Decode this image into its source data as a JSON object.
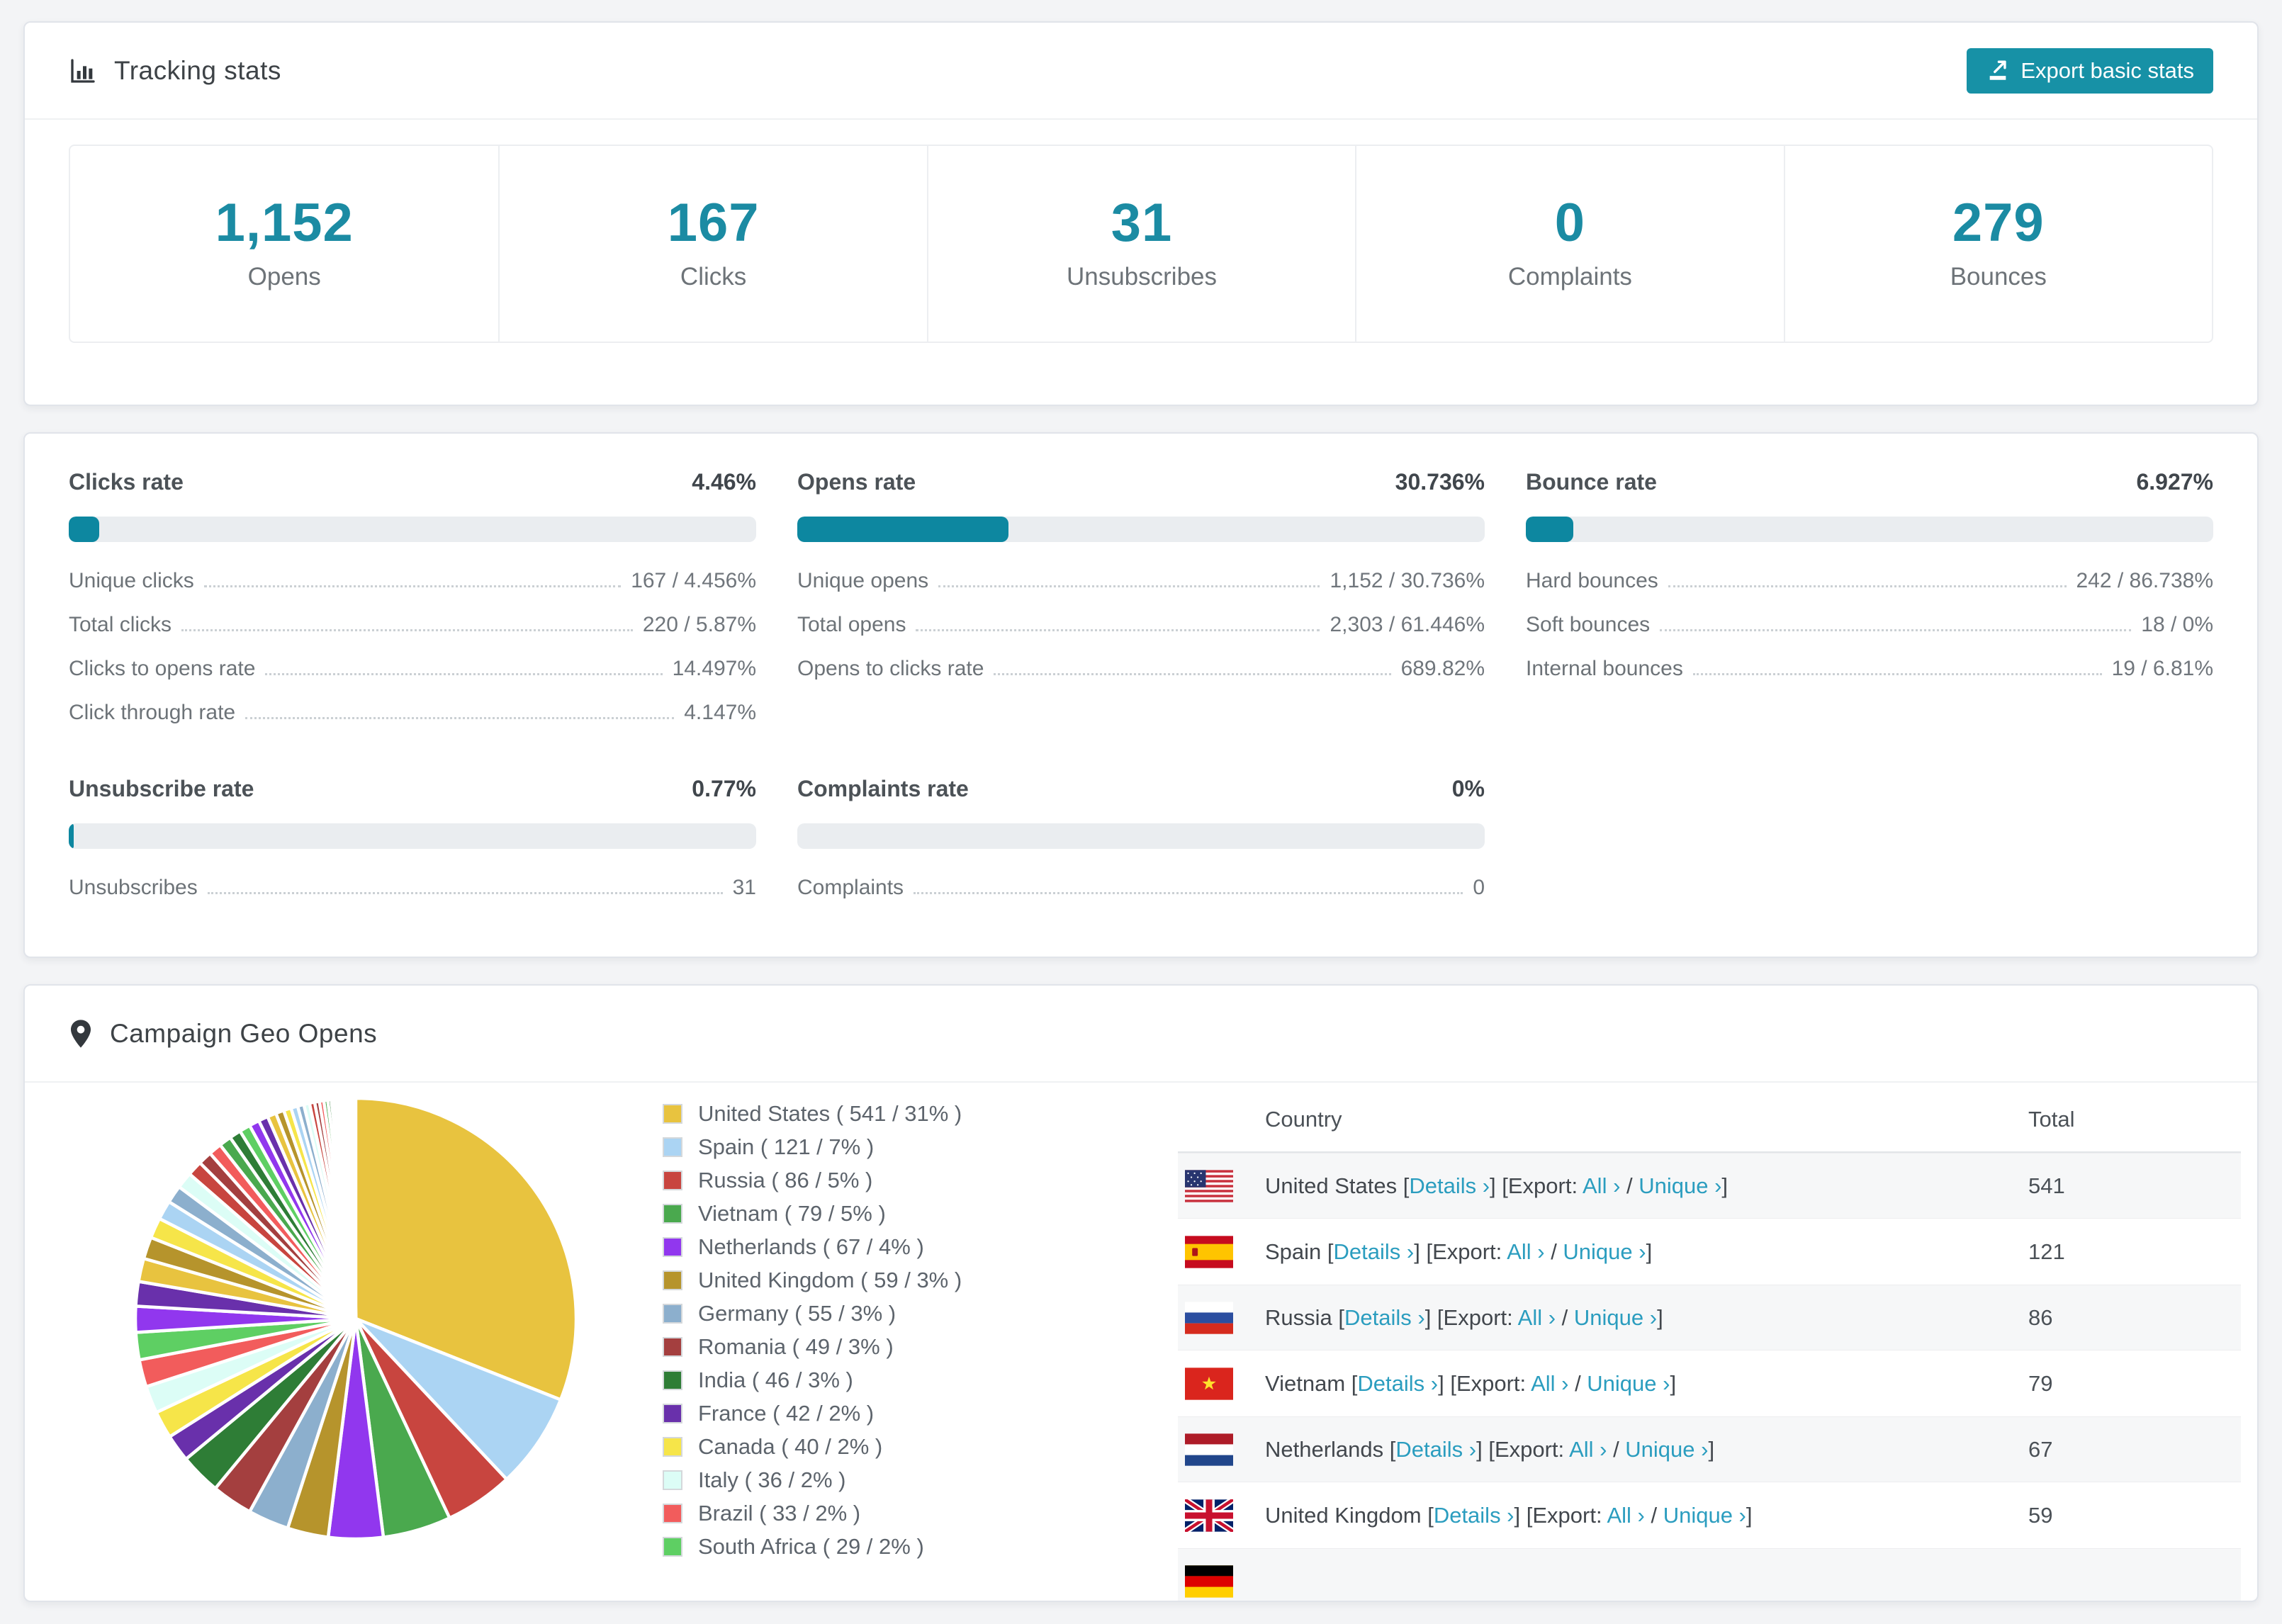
{
  "accent_color": "#1791a6",
  "link_color": "#2b9dbf",
  "header": {
    "title": "Tracking stats",
    "export_label": "Export basic stats"
  },
  "summary_cards": [
    {
      "value": "1,152",
      "label": "Opens"
    },
    {
      "value": "167",
      "label": "Clicks"
    },
    {
      "value": "31",
      "label": "Unsubscribes"
    },
    {
      "value": "0",
      "label": "Complaints"
    },
    {
      "value": "279",
      "label": "Bounces"
    }
  ],
  "rates": [
    {
      "title": "Clicks rate",
      "value": "4.46%",
      "pct": 4.46,
      "rows": [
        {
          "label": "Unique clicks",
          "value": "167 / 4.456%"
        },
        {
          "label": "Total clicks",
          "value": "220 / 5.87%"
        },
        {
          "label": "Clicks to opens rate",
          "value": "14.497%"
        },
        {
          "label": "Click through rate",
          "value": "4.147%"
        }
      ]
    },
    {
      "title": "Opens rate",
      "value": "30.736%",
      "pct": 30.736,
      "rows": [
        {
          "label": "Unique opens",
          "value": "1,152 / 30.736%"
        },
        {
          "label": "Total opens",
          "value": "2,303 / 61.446%"
        },
        {
          "label": "Opens to clicks rate",
          "value": "689.82%"
        }
      ]
    },
    {
      "title": "Bounce rate",
      "value": "6.927%",
      "pct": 6.927,
      "rows": [
        {
          "label": "Hard bounces",
          "value": "242 / 86.738%"
        },
        {
          "label": "Soft bounces",
          "value": "18 / 0%"
        },
        {
          "label": "Internal bounces",
          "value": "19 / 6.81%"
        }
      ]
    },
    {
      "title": "Unsubscribe rate",
      "value": "0.77%",
      "pct": 0.77,
      "rows": [
        {
          "label": "Unsubscribes",
          "value": "31"
        }
      ]
    },
    {
      "title": "Complaints rate",
      "value": "0%",
      "pct": 0,
      "rows": [
        {
          "label": "Complaints",
          "value": "0"
        }
      ]
    }
  ],
  "geo": {
    "title": "Campaign Geo Opens",
    "table": {
      "col_country": "Country",
      "col_total": "Total",
      "link_labels": {
        "details": "Details ›",
        "export_word": "Export:",
        "all": "All ›",
        "unique": "Unique ›",
        "slash": "/",
        "lb": "[",
        "rb": "]"
      },
      "rows": [
        {
          "flag": "us",
          "country": "United States",
          "total": "541"
        },
        {
          "flag": "es",
          "country": "Spain",
          "total": "121"
        },
        {
          "flag": "ru",
          "country": "Russia",
          "total": "86"
        },
        {
          "flag": "vn",
          "country": "Vietnam",
          "total": "79"
        },
        {
          "flag": "nl",
          "country": "Netherlands",
          "total": "67"
        },
        {
          "flag": "gb",
          "country": "United Kingdom",
          "total": "59"
        }
      ],
      "partial_row": {
        "flag": "de"
      }
    }
  },
  "chart_data": {
    "type": "pie",
    "title": "Campaign Geo Opens",
    "legend_position": "right",
    "slices": [
      {
        "label": "United States",
        "value": 541,
        "pct": 31,
        "color": "#e8c33f",
        "legend": "United States ( 541 / 31% )"
      },
      {
        "label": "Spain",
        "value": 121,
        "pct": 7,
        "color": "#abd4f3",
        "legend": "Spain ( 121 / 7% )"
      },
      {
        "label": "Russia",
        "value": 86,
        "pct": 5,
        "color": "#c8453f",
        "legend": "Russia ( 86 / 5% )"
      },
      {
        "label": "Vietnam",
        "value": 79,
        "pct": 5,
        "color": "#4aa94e",
        "legend": "Vietnam ( 79 / 5% )"
      },
      {
        "label": "Netherlands",
        "value": 67,
        "pct": 4,
        "color": "#9137ee",
        "legend": "Netherlands ( 67 / 4% )"
      },
      {
        "label": "United Kingdom",
        "value": 59,
        "pct": 3,
        "color": "#b6942c",
        "legend": "United Kingdom ( 59 / 3% )"
      },
      {
        "label": "Germany",
        "value": 55,
        "pct": 3,
        "color": "#8cafcd",
        "legend": "Germany ( 55 / 3% )"
      },
      {
        "label": "Romania",
        "value": 49,
        "pct": 3,
        "color": "#a43f3f",
        "legend": "Romania ( 49 / 3% )"
      },
      {
        "label": "India",
        "value": 46,
        "pct": 3,
        "color": "#2e7d36",
        "legend": "India ( 46 / 3% )"
      },
      {
        "label": "France",
        "value": 42,
        "pct": 2,
        "color": "#6930ab",
        "legend": "France ( 42 / 2% )"
      },
      {
        "label": "Canada",
        "value": 40,
        "pct": 2,
        "color": "#f6e549",
        "legend": "Canada ( 40 / 2% )"
      },
      {
        "label": "Italy",
        "value": 36,
        "pct": 2,
        "color": "#dcfdf6",
        "legend": "Italy ( 36 / 2% )"
      },
      {
        "label": "Brazil",
        "value": 33,
        "pct": 2,
        "color": "#f25c5c",
        "legend": "Brazil ( 33 / 2% )"
      },
      {
        "label": "South Africa",
        "value": 29,
        "pct": 2,
        "color": "#5ecf63",
        "legend": "South Africa ( 29 / 2% )"
      }
    ],
    "unlabeled_tail_pct": [
      1.9,
      1.8,
      1.7,
      1.6,
      1.5,
      1.4,
      1.3,
      1.2,
      1.1,
      1.0,
      0.95,
      0.9,
      0.85,
      0.8,
      0.75,
      0.7,
      0.65,
      0.6,
      0.55,
      0.5,
      0.46,
      0.42,
      0.38,
      0.35,
      0.32,
      0.29,
      0.26,
      0.23,
      0.2,
      0.18,
      0.16,
      0.14,
      0.12,
      0.1,
      0.09,
      0.08,
      0.07,
      0.06,
      0.05,
      0.04,
      0.03,
      0.02
    ]
  }
}
